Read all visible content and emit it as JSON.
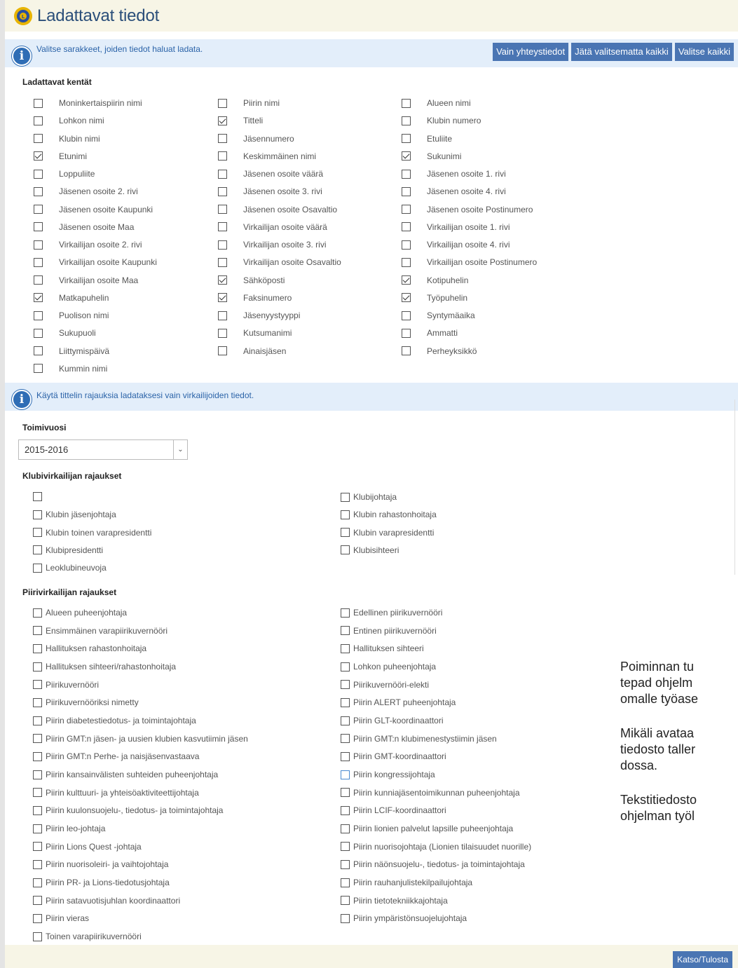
{
  "title": "Ladattavat tiedot",
  "info1": "Valitse sarakkeet, joiden tiedot haluat ladata.",
  "buttons": {
    "contacts_only": "Vain yhteystiedot",
    "deselect_all": "Jätä valitsematta kaikki",
    "select_all": "Valitse kaikki"
  },
  "fields_heading": "Ladattavat kentät",
  "fields": [
    {
      "label": "Moninkertaispiirin nimi",
      "checked": false
    },
    {
      "label": "Piirin nimi",
      "checked": false
    },
    {
      "label": "Alueen nimi",
      "checked": false
    },
    {
      "label": "Lohkon nimi",
      "checked": false
    },
    {
      "label": "Titteli",
      "checked": true
    },
    {
      "label": "Klubin numero",
      "checked": false
    },
    {
      "label": "Klubin nimi",
      "checked": false
    },
    {
      "label": "Jäsennumero",
      "checked": false
    },
    {
      "label": "Etuliite",
      "checked": false
    },
    {
      "label": "Etunimi",
      "checked": true
    },
    {
      "label": "Keskimmäinen nimi",
      "checked": false
    },
    {
      "label": "Sukunimi",
      "checked": true
    },
    {
      "label": "Loppuliite",
      "checked": false
    },
    {
      "label": "Jäsenen osoite väärä",
      "checked": false
    },
    {
      "label": "Jäsenen osoite 1. rivi",
      "checked": false
    },
    {
      "label": "Jäsenen osoite 2. rivi",
      "checked": false
    },
    {
      "label": "Jäsenen osoite 3. rivi",
      "checked": false
    },
    {
      "label": "Jäsenen osoite 4. rivi",
      "checked": false
    },
    {
      "label": "Jäsenen osoite Kaupunki",
      "checked": false
    },
    {
      "label": "Jäsenen osoite Osavaltio",
      "checked": false
    },
    {
      "label": "Jäsenen osoite Postinumero",
      "checked": false
    },
    {
      "label": "Jäsenen osoite Maa",
      "checked": false
    },
    {
      "label": "Virkailijan osoite väärä",
      "checked": false
    },
    {
      "label": "Virkailijan osoite 1. rivi",
      "checked": false
    },
    {
      "label": "Virkailijan osoite 2. rivi",
      "checked": false
    },
    {
      "label": "Virkailijan osoite 3. rivi",
      "checked": false
    },
    {
      "label": "Virkailijan osoite 4. rivi",
      "checked": false
    },
    {
      "label": "Virkailijan osoite Kaupunki",
      "checked": false
    },
    {
      "label": "Virkailijan osoite Osavaltio",
      "checked": false
    },
    {
      "label": "Virkailijan osoite Postinumero",
      "checked": false
    },
    {
      "label": "Virkailijan osoite Maa",
      "checked": false
    },
    {
      "label": "Sähköposti",
      "checked": true
    },
    {
      "label": "Kotipuhelin",
      "checked": true
    },
    {
      "label": "Matkapuhelin",
      "checked": true
    },
    {
      "label": "Faksinumero",
      "checked": true
    },
    {
      "label": "Työpuhelin",
      "checked": true
    },
    {
      "label": "Puolison nimi",
      "checked": false
    },
    {
      "label": "Jäsenyystyyppi",
      "checked": false
    },
    {
      "label": "Syntymäaika",
      "checked": false
    },
    {
      "label": "Sukupuoli",
      "checked": false
    },
    {
      "label": "Kutsumanimi",
      "checked": false
    },
    {
      "label": "Ammatti",
      "checked": false
    },
    {
      "label": "Liittymispäivä",
      "checked": false
    },
    {
      "label": "Ainaisjäsen",
      "checked": false
    },
    {
      "label": "Perheyksikkö",
      "checked": false
    },
    {
      "label": "Kummin nimi",
      "checked": false
    }
  ],
  "info2": "Käytä tittelin rajauksia ladataksesi vain virkailijoiden tiedot.",
  "year_label": "Toimivuosi",
  "year_value": "2015-2016",
  "club_heading": "Klubivirkailijan rajaukset",
  "club_left": [
    "",
    "Klubin jäsenjohtaja",
    "Klubin toinen varapresidentti",
    "Klubipresidentti",
    "Leoklubineuvoja"
  ],
  "club_right": [
    "Klubijohtaja",
    "Klubin rahastonhoitaja",
    "Klubin varapresidentti",
    "Klubisihteeri"
  ],
  "district_heading": "Piirivirkailijan rajaukset",
  "district_left": [
    "Alueen puheenjohtaja",
    "Ensimmäinen varapiirikuvernööri",
    "Hallituksen rahastonhoitaja",
    "Hallituksen sihteeri/rahastonhoitaja",
    "Piirikuvernööri",
    "Piirikuvernööriksi nimetty",
    "Piirin diabetestiedotus- ja toimintajohtaja",
    "Piirin GMT:n jäsen- ja uusien klubien kasvutiimin jäsen",
    "Piirin GMT:n Perhe- ja naisjäsenvastaava",
    "Piirin kansainvälisten suhteiden puheenjohtaja",
    "Piirin kulttuuri- ja yhteisöaktiviteettijohtaja",
    "Piirin kuulonsuojelu-, tiedotus- ja toimintajohtaja",
    "Piirin leo-johtaja",
    "Piirin Lions Quest -johtaja",
    "Piirin nuorisoleiri- ja vaihtojohtaja",
    "Piirin PR- ja Lions-tiedotusjohtaja",
    "Piirin satavuotisjuhlan koordinaattori",
    "Piirin vieras",
    "Toinen varapiirikuvernööri"
  ],
  "district_right": [
    "Edellinen piirikuvernööri",
    "Entinen piirikuvernööri",
    "Hallituksen sihteeri",
    "Lohkon puheenjohtaja",
    "Piirikuvernööri-elekti",
    "Piirin ALERT puheenjohtaja",
    "Piirin GLT-koordinaattori",
    "Piirin GMT:n klubimenestystiimin jäsen",
    "Piirin GMT-koordinaattori",
    "Piirin kongressijohtaja",
    "Piirin kunniajäsentoimikunnan puheenjohtaja",
    "Piirin LCIF-koordinaattori",
    "Piirin lionien palvelut lapsille puheenjohtaja",
    "Piirin nuorisojohtaja (Lionien tilaisuudet nuorille)",
    "Piirin näönsuojelu-, tiedotus- ja toimintajohtaja",
    "Piirin rauhanjulistekilpailujohtaja",
    "Piirin tietotekniikkajohtaja",
    "Piirin ympäristönsuojelujohtaja"
  ],
  "side_text": [
    "Poiminnan tu",
    "tepad ohjelm",
    "omalle työase",
    "Mikäli avataa",
    "tiedosto taller",
    "dossa.",
    "Tekstitiedosto",
    "ohjelman työl"
  ],
  "footer_button": "Katso/Tulosta"
}
